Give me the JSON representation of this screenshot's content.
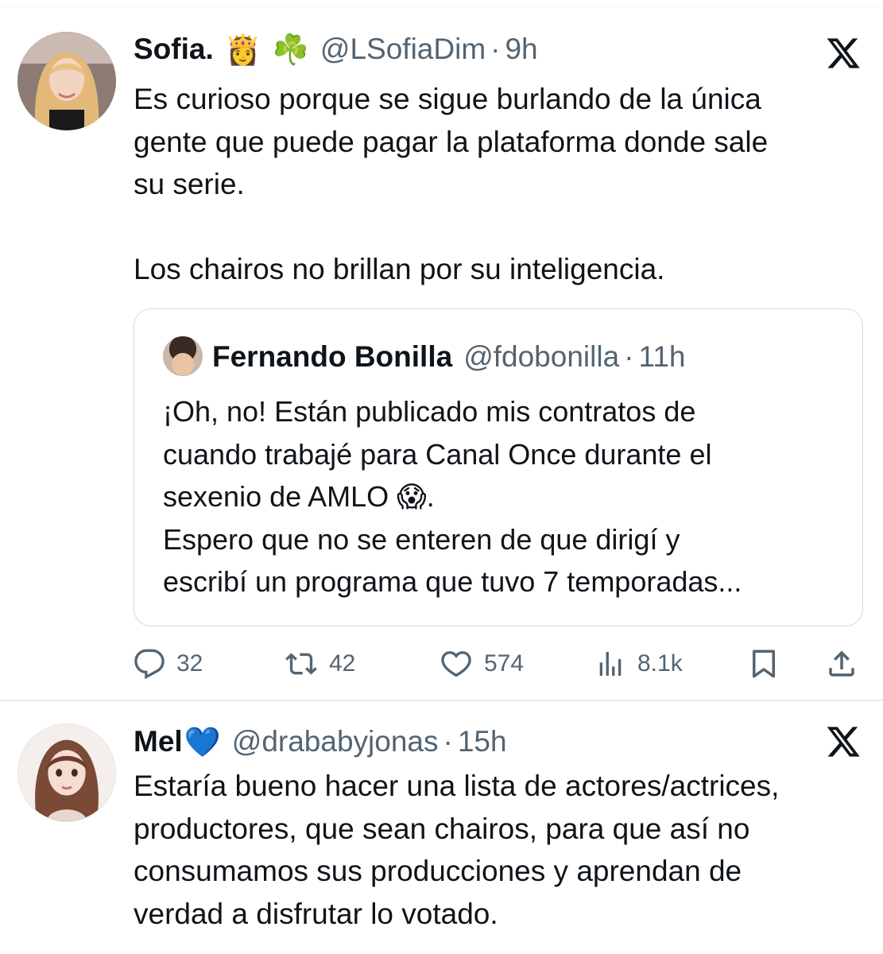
{
  "tweets": [
    {
      "name": "Sofia.",
      "badges": [
        "👸",
        "☘️"
      ],
      "handle": "@LSofiaDim",
      "dot": "·",
      "time": "9h",
      "text": "Es curioso porque se sigue burlando de la única\ngente que puede pagar la plataforma donde sale\nsu serie.\n\nLos chairos no brillan por su inteligencia.",
      "quote": {
        "name": "Fernando Bonilla",
        "handle": "@fdobonilla",
        "dot": "·",
        "time": "11h",
        "text": "¡Oh, no! Están publicado mis contratos de\ncuando trabajé para Canal Once durante el\nsexenio de AMLO 😱.\nEspero que no se enteren de que dirigí y\nescribí un programa que tuvo 7 temporadas..."
      },
      "actions": {
        "replies": "32",
        "reposts": "42",
        "likes": "574",
        "views": "8.1k"
      },
      "icons": [
        "reply-icon",
        "repost-icon",
        "like-icon",
        "views-icon",
        "bookmark-icon",
        "share-icon",
        "x-logo-icon"
      ]
    },
    {
      "name": "Mel",
      "badges": [
        "💙"
      ],
      "handle": "@drababyjonas",
      "dot": "·",
      "time": "15h",
      "text": "Estaría bueno hacer una lista de actores/actrices,\nproductores,  que sean chairos, para que así no\nconsumamos sus producciones y aprendan de\nverdad a disfrutar lo votado."
    }
  ],
  "colors": {
    "text": "#0f1419",
    "muted": "#536471",
    "border": "#cfd9de"
  }
}
